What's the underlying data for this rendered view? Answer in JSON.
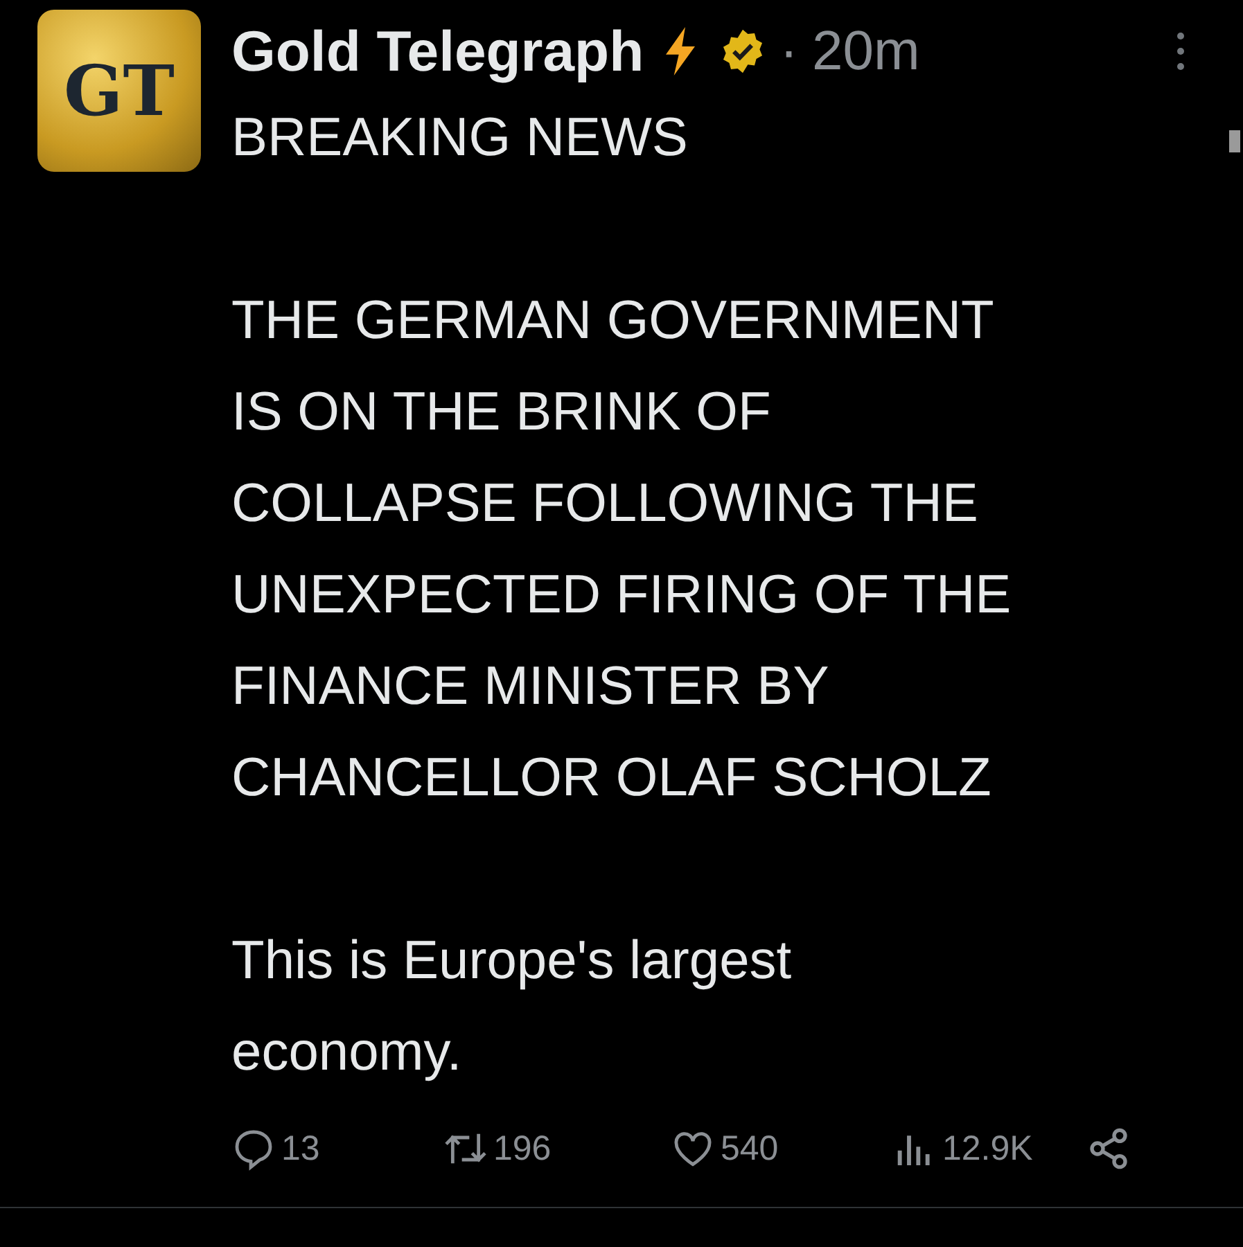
{
  "post": {
    "avatar_text": "GT",
    "author": "Gold Telegraph",
    "separator": "·",
    "time": "20m",
    "paragraphs": [
      "BREAKING NEWS",
      "THE GERMAN GOVERNMENT\nIS ON THE BRINK OF\nCOLLAPSE FOLLOWING THE\nUNEXPECTED FIRING OF THE\nFINANCE MINISTER BY\nCHANCELLOR OLAF SCHOLZ",
      "This is Europe's largest\neconomy."
    ],
    "actions": [
      {
        "kind": "reply",
        "count": "13"
      },
      {
        "kind": "repost",
        "count": "196"
      },
      {
        "kind": "like",
        "count": "540"
      },
      {
        "kind": "views",
        "count": "12.9K"
      },
      {
        "kind": "share"
      }
    ]
  }
}
